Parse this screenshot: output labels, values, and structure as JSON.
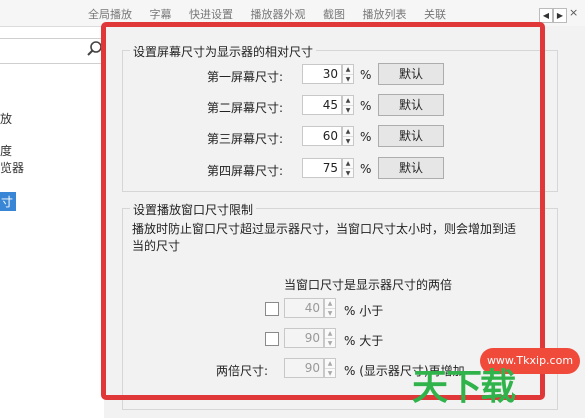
{
  "topbar": {
    "tabs": [
      "全局播放",
      "字幕",
      "快进设置",
      "播放器外观",
      "截图",
      "播放列表",
      "关联"
    ],
    "scroll_left": "◀",
    "scroll_right": "▶",
    "close": "×"
  },
  "sidebar": {
    "items": [
      "放",
      "度",
      "览器",
      "寸"
    ],
    "selected": "寸"
  },
  "screen_group": {
    "title": "设置屏幕尺寸为显示器的相对尺寸",
    "rows": [
      {
        "label": "第一屏幕尺寸:",
        "value": "30",
        "unit": "%",
        "button": "默认"
      },
      {
        "label": "第二屏幕尺寸:",
        "value": "45",
        "unit": "%",
        "button": "默认"
      },
      {
        "label": "第三屏幕尺寸:",
        "value": "60",
        "unit": "%",
        "button": "默认"
      },
      {
        "label": "第四屏幕尺寸:",
        "value": "75",
        "unit": "%",
        "button": "默认"
      }
    ]
  },
  "limit_group": {
    "title": "设置播放窗口尺寸限制",
    "desc_line1": "播放时防止窗口尺寸超过显示器尺寸，当窗口尺寸太小时，则会增加到适",
    "desc_line2": "当的尺寸",
    "double_heading": "当窗口尺寸是显示器尺寸的两倍",
    "less_value": "40",
    "less_unit": "% 小于",
    "greater_value": "90",
    "greater_unit": "% 大于",
    "double_label": "两倍尺寸:",
    "double_value": "90",
    "double_unit": "% (显示器尺寸)再增加"
  },
  "watermark": {
    "url": "www.Tkxip.com",
    "text": "天下载"
  },
  "colors": {
    "highlight_frame": "#e03838",
    "selected_item": "#3a86d6",
    "watermark_green": "#2fb34a",
    "watermark_red": "#ef4a3a"
  }
}
